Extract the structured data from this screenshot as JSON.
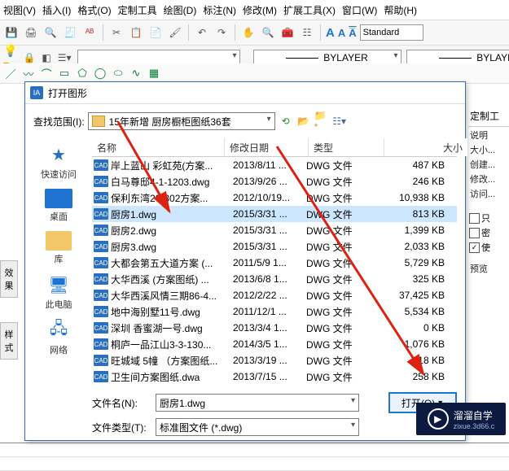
{
  "menu": {
    "items": [
      "视图(V)",
      "插入(I)",
      "格式(O)",
      "定制工具",
      "绘图(D)",
      "标注(N)",
      "修改(M)",
      "扩展工具(X)",
      "窗口(W)",
      "帮助(H)"
    ]
  },
  "style_dropdown": "Standard",
  "layer_row": {
    "bylayer1": "BYLAYER",
    "bylayer2": "BYLAYER"
  },
  "left_tags": {
    "t1": "效果",
    "t2": "样式"
  },
  "dialog": {
    "title": "打开图形",
    "lookin_label": "查找范围(I):",
    "lookin_value": "15年新增 厨房橱柜图纸36套",
    "places": [
      {
        "icon": "star",
        "label": "快速访问",
        "color": "#2a6fbf"
      },
      {
        "icon": "desktop",
        "label": "桌面",
        "color": "#1e74d0"
      },
      {
        "icon": "folder",
        "label": "库",
        "color": "#f3c769"
      },
      {
        "icon": "pc",
        "label": "此电脑",
        "color": "#1e74d0"
      },
      {
        "icon": "net",
        "label": "网络",
        "color": "#1e74d0"
      }
    ],
    "columns": {
      "name": "名称",
      "date": "修改日期",
      "type": "类型",
      "size": "大小"
    },
    "rows": [
      {
        "name": "岸上蓝山 彩虹苑(方案...",
        "date": "2013/8/11 ...",
        "type": "DWG 文件",
        "size": "487 KB"
      },
      {
        "name": "白马尊邸4-1-1203.dwg",
        "date": "2013/9/26 ...",
        "type": "DWG 文件",
        "size": "246 KB"
      },
      {
        "name": "保利东湾20-302方案...",
        "date": "2012/10/19...",
        "type": "DWG 文件",
        "size": "10,938 KB"
      },
      {
        "name": "厨房1.dwg",
        "date": "2015/3/31 ...",
        "type": "DWG 文件",
        "size": "813 KB",
        "selected": true
      },
      {
        "name": "厨房2.dwg",
        "date": "2015/3/31 ...",
        "type": "DWG 文件",
        "size": "1,399 KB"
      },
      {
        "name": "厨房3.dwg",
        "date": "2015/3/31 ...",
        "type": "DWG 文件",
        "size": "2,033 KB"
      },
      {
        "name": "大都会第五大道方案 (...",
        "date": "2011/5/9 1...",
        "type": "DWG 文件",
        "size": "5,729 KB"
      },
      {
        "name": "大华西溪 (方案图纸) ...",
        "date": "2013/6/8 1...",
        "type": "DWG 文件",
        "size": "325 KB"
      },
      {
        "name": "大华西溪风情三期86-4...",
        "date": "2012/2/22 ...",
        "type": "DWG 文件",
        "size": "37,425 KB"
      },
      {
        "name": "地中海别墅11号.dwg",
        "date": "2011/12/1 ...",
        "type": "DWG 文件",
        "size": "5,534 KB"
      },
      {
        "name": "深圳 香蜜湖一号.dwg",
        "date": "2013/3/4 1...",
        "type": "DWG 文件",
        "size": "0 KB"
      },
      {
        "name": "桐庐一品江山3-3-130...",
        "date": "2014/3/5 1...",
        "type": "DWG 文件",
        "size": "1,076 KB"
      },
      {
        "name": "旺城域 5幢 （方案图纸...",
        "date": "2013/3/19 ...",
        "type": "DWG 文件",
        "size": "818 KB"
      },
      {
        "name": "卫生间方案图纸.dwa",
        "date": "2013/7/15 ...",
        "type": "DWG 文件",
        "size": "258 KB"
      }
    ],
    "filename_label": "文件名(N):",
    "filename_value": "厨房1.dwg",
    "filetype_label": "文件类型(T):",
    "filetype_value": "标准图文件 (*.dwg)",
    "open_button": "打开(O)"
  },
  "right": {
    "header": "定制工",
    "items": [
      "说明",
      "大小...",
      "创建...",
      "修改...",
      "访问..."
    ],
    "chk1": "只",
    "chk2": "密",
    "chk3": "使",
    "preview": "预览"
  },
  "watermark": {
    "line1": "溜溜自学",
    "line2": "zixue.3d66.c"
  }
}
